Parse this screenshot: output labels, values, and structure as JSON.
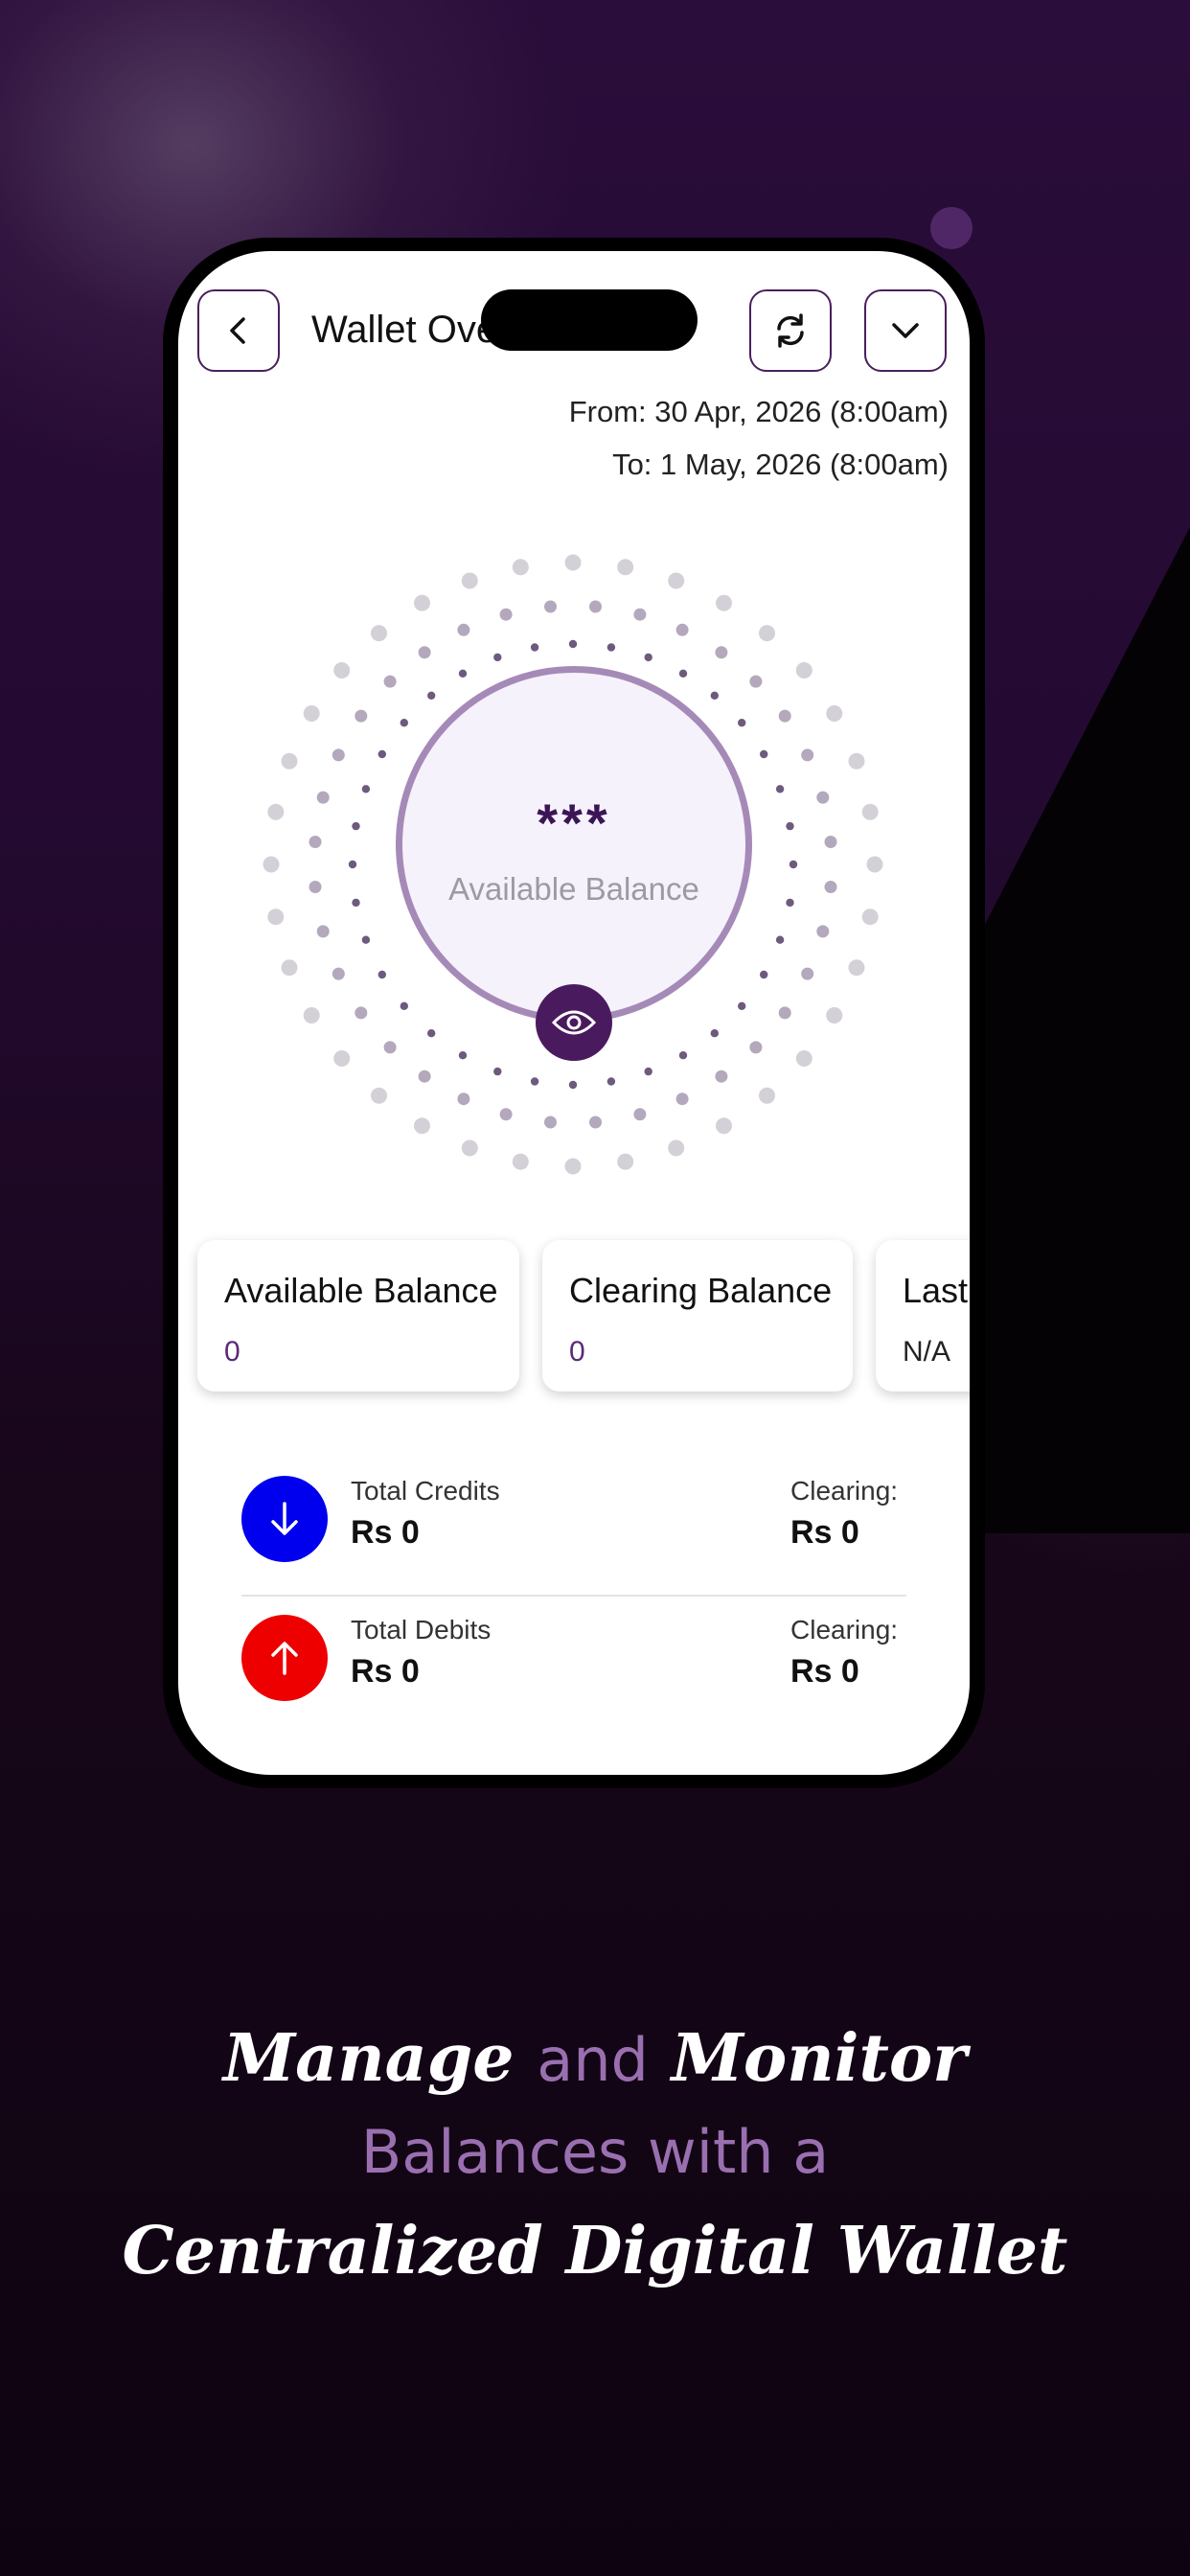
{
  "header": {
    "title": "Wallet Overview"
  },
  "period": {
    "from": "From: 30 Apr, 2026 (8:00am)",
    "to": "To: 1 May, 2026 (8:00am)"
  },
  "balance_display": {
    "masked_value": "***",
    "label": "Available Balance"
  },
  "cards": [
    {
      "title": "Available Balance",
      "value": "0"
    },
    {
      "title": "Clearing Balance",
      "value": "0"
    },
    {
      "title": "Last",
      "value": "N/A"
    }
  ],
  "transactions": [
    {
      "label": "Total Credits",
      "amount": "Rs  0",
      "clearing_label": "Clearing:",
      "clearing_amount": "Rs  0",
      "color": "#0000ee",
      "icon": "arrow-down-icon"
    },
    {
      "label": "Total Debits",
      "amount": "Rs  0",
      "clearing_label": "Clearing:",
      "clearing_amount": "Rs  0",
      "color": "#ee0000",
      "icon": "arrow-up-icon"
    }
  ],
  "tagline": {
    "word1": "Manage",
    "and": "and",
    "word2": "Monitor",
    "line2": "Balances with a",
    "line3": "Centralized Digital Wallet"
  },
  "colors": {
    "accent": "#4a1a5e",
    "ring": "#a58ab8",
    "credit": "#0000ee",
    "debit": "#ee0000"
  }
}
